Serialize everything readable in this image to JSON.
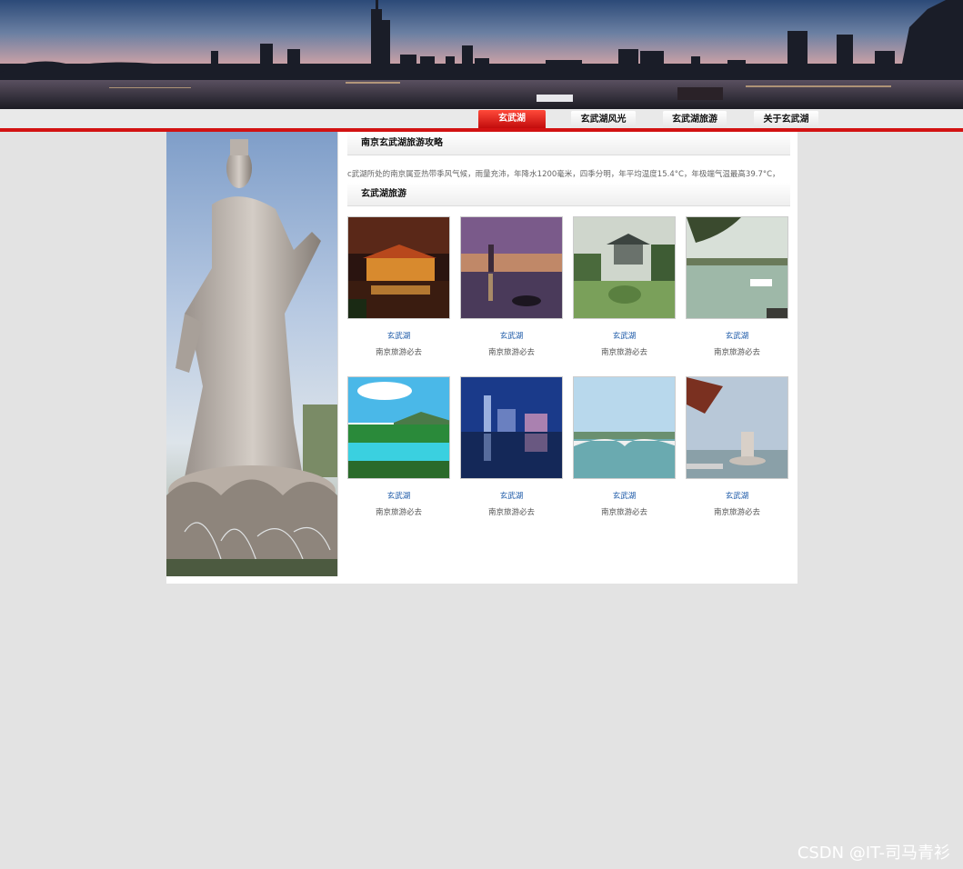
{
  "nav": {
    "items": [
      {
        "label": "玄武湖",
        "active": true
      },
      {
        "label": "玄武湖风光",
        "active": false
      },
      {
        "label": "玄武湖旅游",
        "active": false
      },
      {
        "label": "关于玄武湖",
        "active": false
      }
    ]
  },
  "guide": {
    "title": "南京玄武湖旅游攻略",
    "text": "c武湖所处的南京属亚热带季风气候，雨量充沛，年降水1200毫米，四季分明，年平均温度15.4°C，年极端气温最高39.7°C，"
  },
  "tour": {
    "title": "玄武湖旅游",
    "cards": [
      {
        "title": "玄武湖",
        "subtitle": "南京旅游必去"
      },
      {
        "title": "玄武湖",
        "subtitle": "南京旅游必去"
      },
      {
        "title": "玄武湖",
        "subtitle": "南京旅游必去"
      },
      {
        "title": "玄武湖",
        "subtitle": "南京旅游必去"
      },
      {
        "title": "玄武湖",
        "subtitle": "南京旅游必去"
      },
      {
        "title": "玄武湖",
        "subtitle": "南京旅游必去"
      },
      {
        "title": "玄武湖",
        "subtitle": "南京旅游必去"
      },
      {
        "title": "玄武湖",
        "subtitle": "南京旅游必去"
      }
    ]
  },
  "watermark": "CSDN @IT-司马青衫",
  "colors": {
    "accent_red": "#d21212",
    "link_blue": "#1d5aa8",
    "page_bg": "#e3e3e3"
  }
}
